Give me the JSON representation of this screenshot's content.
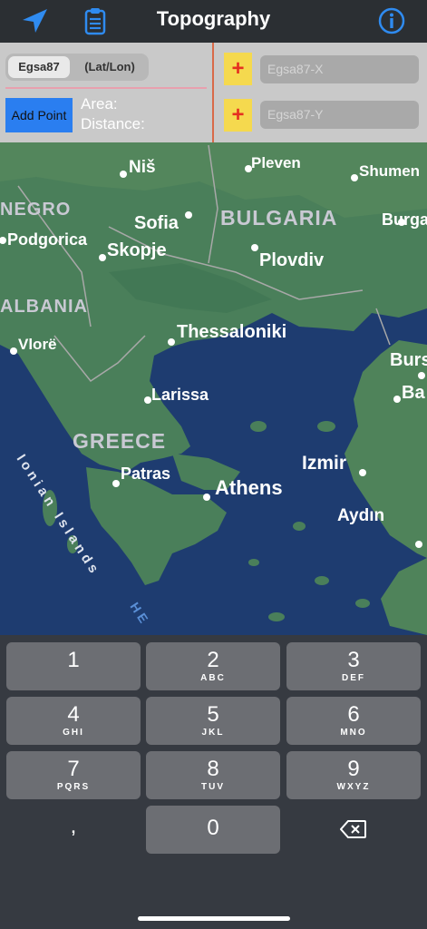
{
  "header": {
    "title": "Topography"
  },
  "panel": {
    "segments": [
      "Egsa87",
      "(Lat/Lon)"
    ],
    "add_point": "Add Point",
    "area_label": "Area:",
    "distance_label": "Distance:",
    "plus_symbol": "+",
    "x_placeholder": "Egsa87-X",
    "y_placeholder": "Egsa87-Y"
  },
  "map": {
    "cities": [
      "Niš",
      "Pleven",
      "Shumen",
      "Sofia",
      "Burga",
      "Podgorica",
      "Skopje",
      "Plovdiv",
      "Vlorë",
      "Thessaloniki",
      "Burs",
      "Larissa",
      "Ba",
      "Patras",
      "Athens",
      "Izmir",
      "Aydın"
    ],
    "regions": [
      "NEGRO",
      "BULGARIA",
      "ALBANIA",
      "GREECE"
    ],
    "seas": [
      "Ionian Islands",
      "HE"
    ]
  },
  "keyboard": {
    "keys": [
      {
        "d": "1",
        "s": ""
      },
      {
        "d": "2",
        "s": "ABC"
      },
      {
        "d": "3",
        "s": "DEF"
      },
      {
        "d": "4",
        "s": "GHI"
      },
      {
        "d": "5",
        "s": "JKL"
      },
      {
        "d": "6",
        "s": "MNO"
      },
      {
        "d": "7",
        "s": "PQRS"
      },
      {
        "d": "8",
        "s": "TUV"
      },
      {
        "d": "9",
        "s": "WXYZ"
      },
      {
        "d": ",",
        "s": ""
      },
      {
        "d": "0",
        "s": ""
      }
    ]
  }
}
